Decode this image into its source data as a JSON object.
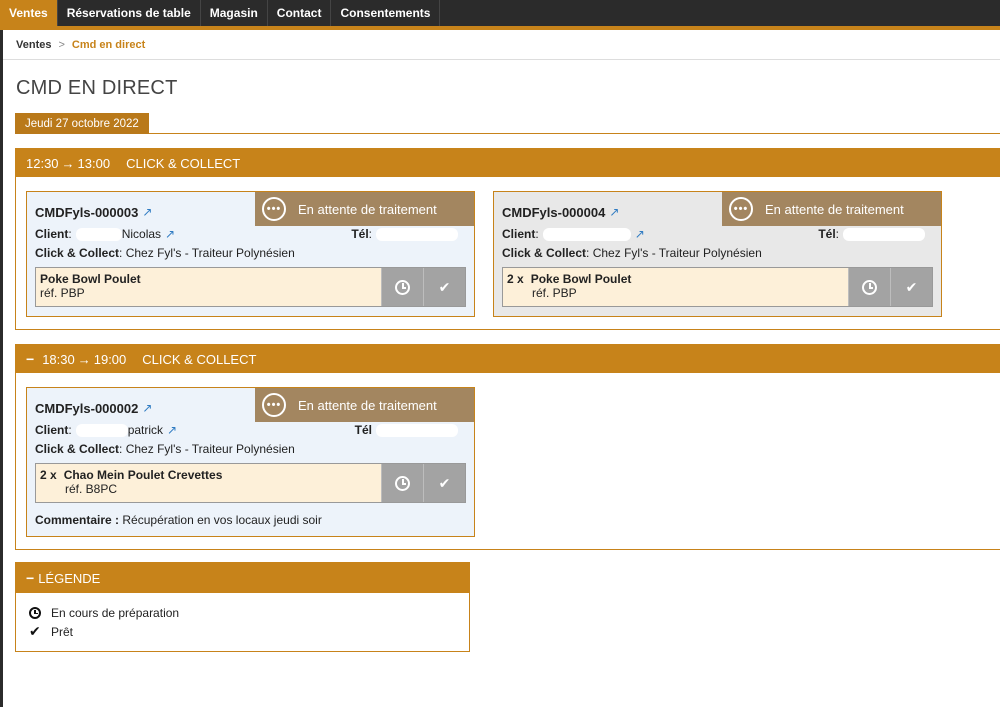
{
  "topnav": {
    "items": [
      {
        "label": "Ventes",
        "active": true
      },
      {
        "label": "Réservations de table",
        "active": false
      },
      {
        "label": "Magasin",
        "active": false
      },
      {
        "label": "Contact",
        "active": false
      },
      {
        "label": "Consentements",
        "active": false
      }
    ]
  },
  "breadcrumb": {
    "home": "Ventes",
    "separator": ">",
    "current": "Cmd en direct"
  },
  "page": {
    "title": "CMD EN DIRECT",
    "date_tab": "Jeudi 27 octobre 2022"
  },
  "labels": {
    "client": "Client",
    "tel": "Tél",
    "click_collect": "Click & Collect",
    "comment": "Commentaire :",
    "ref_prefix": "réf.",
    "colon": " :"
  },
  "slots": [
    {
      "start": "12:30",
      "end": "13:00",
      "type": "CLICK & COLLECT",
      "collapse_icon": "",
      "orders": [
        {
          "ref": "CMDFyls-000003",
          "status": "En attente de traitement",
          "client_name": "Nicolas",
          "pickup": "Chez Fyl's - Traiteur Polynésien",
          "products": [
            {
              "qty": "",
              "name": "Poke Bowl Poulet",
              "ref": "réf. PBP"
            }
          ],
          "comment": ""
        },
        {
          "ref": "CMDFyls-000004",
          "status": "En attente de traitement",
          "client_name": "",
          "pickup": "Chez Fyl's - Traiteur Polynésien",
          "products": [
            {
              "qty": "2 x",
              "name": "Poke Bowl Poulet",
              "ref": "réf. PBP"
            }
          ],
          "comment": ""
        }
      ]
    },
    {
      "start": "18:30",
      "end": "19:00",
      "type": "CLICK & COLLECT",
      "collapse_icon": "−",
      "orders": [
        {
          "ref": "CMDFyls-000002",
          "status": "En attente de traitement",
          "client_name": "patrick",
          "pickup": "Chez Fyl's - Traiteur Polynésien",
          "products": [
            {
              "qty": "2 x",
              "name": "Chao Mein Poulet Crevettes",
              "ref": "réf. B8PC"
            }
          ],
          "comment": "Récupération en vos locaux jeudi soir"
        }
      ]
    }
  ],
  "legend": {
    "title": "LÉGENDE",
    "collapse_icon": "−",
    "items": [
      {
        "icon": "clock-icon",
        "label": "En cours de préparation"
      },
      {
        "icon": "check-icon",
        "label": "Prêt"
      }
    ]
  },
  "colors": {
    "accent": "#c7831a",
    "status_bg": "#a38660",
    "nav_bg": "#2b2b2b",
    "order_bg": "#edf3fa",
    "product_bg": "#fdf0d9",
    "link": "#2f7bc2"
  },
  "icons": {
    "arrow": "→",
    "external": "↗",
    "check": "✔",
    "dots": "•••"
  }
}
